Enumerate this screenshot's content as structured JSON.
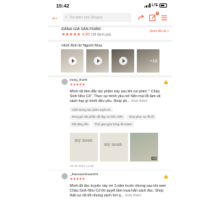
{
  "status_bar": {
    "time": "15:42",
    "network": "LTE"
  },
  "header": {
    "search_placeholder": "Tìm kiếm trên Shopee",
    "cart_badge": "9"
  },
  "rating": {
    "title": "ĐÁNH GIÁ SẢN PHẨM",
    "stars": "★★★★★",
    "score": "4.9/5",
    "count": "(38 đánh giá)",
    "see_all": "Xem tất cả >"
  },
  "photos": {
    "title": "Hình Ảnh từ Người Mua",
    "more_count": "+18"
  },
  "reviews": [
    {
      "user": "trang_thu06",
      "stars": "★★★★★",
      "text": "Mình rất tâm đắc tác phẩm này sau khi coi phim :\" Châu Sinh Như Cố\". Thực sự mình yêu nó! Nên mọi lỗi lầm về sách hay gì mình đều yêu. Shop ph...",
      "more": "Xem thêm",
      "tags": [
        "Chất lượng sản phẩm tuyệt vời",
        "Đóng gói sản phẩm rất đẹp và chắc chắn",
        "Shop phục vụ rất tốt",
        "Rất đáng tiền",
        "Thời gian giao hàng rất nhanh"
      ],
      "photo_label": "my noan",
      "photo_count": "+3",
      "date": "10-10-2021 12:38"
    },
    {
      "user": "_thanuuenhoa2204",
      "stars": "★★★★★",
      "text": "Mình đã đọc truyện này ơri 3 năm trước nhưng sau khi xem Châu Sinh Như Cố thì quyết tâm mua hẳn sách đọc. Shop thật sự rất tốt nhưng sách hơi q...",
      "more": "Xem thêm"
    }
  ],
  "colors": {
    "accent": "#ee4d2d"
  }
}
